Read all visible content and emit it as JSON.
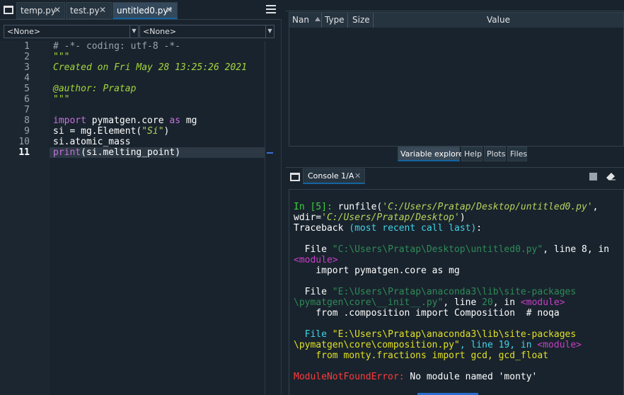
{
  "editor": {
    "tabs": [
      {
        "label": "temp.py",
        "close": "✕"
      },
      {
        "label": "test.py",
        "close": "✕"
      },
      {
        "label": "untitled0.py*",
        "close": "✕"
      }
    ],
    "class_combo": "<None>",
    "function_combo": "<None>",
    "lines": [
      {
        "n": "1",
        "text": "# -*- coding: utf-8 -*-"
      },
      {
        "n": "2",
        "text": "\"\"\""
      },
      {
        "n": "3",
        "text": "Created on Fri May 28 13:25:26 2021"
      },
      {
        "n": "4",
        "text": ""
      },
      {
        "n": "5",
        "text": "@author: Pratap"
      },
      {
        "n": "6",
        "text": "\"\"\""
      },
      {
        "n": "7",
        "text": ""
      },
      {
        "n": "8",
        "kw1": "import",
        "mid": " pymatgen.core ",
        "kw2": "as",
        "tail": " mg"
      },
      {
        "n": "9",
        "pre": "si = mg.Element(",
        "str": "\"Si\"",
        "post": ")"
      },
      {
        "n": "10",
        "text": "si.atomic_mass"
      },
      {
        "n": "11",
        "kw": "print",
        "rest": "(si.melting_point)"
      }
    ]
  },
  "variable_explorer": {
    "columns": [
      "Nan",
      "Type",
      "Size",
      "Value"
    ],
    "tabs": [
      "Variable explorer",
      "Help",
      "Plots",
      "Files"
    ]
  },
  "console": {
    "tab_label": "Console 1/A",
    "tab_close": "✕",
    "output": {
      "prompt": "In [5]:",
      "runfile_pre": " runfile(",
      "runfile_arg1": "'C:/Users/Pratap/Desktop/untitled0.py'",
      "runfile_comma": ",",
      "wdir_pre": "wdir=",
      "wdir_arg": "'C:/Users/Pratap/Desktop'",
      "wdir_post": ")",
      "traceback": "Traceback",
      "traceback_note": "(most recent call last)",
      "traceback_colon": ":",
      "f1_file": "  File ",
      "f1_path": "\"C:\\Users\\Pratap\\Desktop\\untitled0.py\"",
      "f1_line": ", line 8, in",
      "f1_module": "<module>",
      "f1_code": "    import pymatgen.core as mg",
      "f2_file": "  File ",
      "f2_path1": "\"E:\\Users\\Pratap\\anaconda3\\lib\\site-packages",
      "f2_path2": "\\pymatgen\\core\\__init__.py\"",
      "f2_line_pre": ", line ",
      "f2_lineno": "20",
      "f2_in": ", in ",
      "f2_module": "<module>",
      "f2_code": "    from .composition import Composition  # noqa",
      "f3_file": "  File ",
      "f3_path1": "\"E:\\Users\\Pratap\\anaconda3\\lib\\site-packages",
      "f3_path2": "\\pymatgen\\core\\composition.py\"",
      "f3_line": ", line 19, in ",
      "f3_module": "<module>",
      "f3_code": "    from monty.fractions import gcd, gcd_float",
      "error_name": "ModuleNotFoundError:",
      "error_msg": " No module named 'monty'"
    }
  },
  "colors": {
    "background": "#19232d",
    "accent": "#1464a0",
    "error": "#ff3b3b",
    "prompt": "#3fcf3f"
  }
}
